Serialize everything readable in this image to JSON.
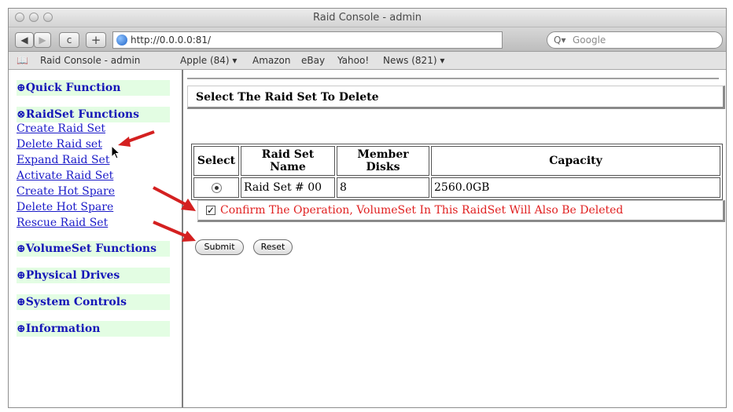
{
  "window": {
    "title": "Raid Console - admin"
  },
  "toolbar": {
    "url": "http://0.0.0.0:81/",
    "search_placeholder": "Google",
    "reload_glyph": "c",
    "add_glyph": "+"
  },
  "bookmarks": [
    "Raid Console - admin",
    "Apple (84) ▾",
    "Amazon",
    "eBay",
    "Yahoo!",
    "News (821) ▾"
  ],
  "sidebar": {
    "quick_function": "⊕Quick Function",
    "raidset_functions": "⊗RaidSet Functions",
    "raidset_links": [
      "Create Raid Set",
      "Delete Raid set",
      "Expand Raid Set",
      "Activate Raid Set",
      "Create Hot Spare",
      "Delete Hot Spare",
      "Rescue Raid Set"
    ],
    "volumeset_functions": "⊕VolumeSet Functions",
    "physical_drives": "⊕Physical Drives",
    "system_controls": "⊕System Controls",
    "information": "⊕Information"
  },
  "main": {
    "heading": "Select The Raid Set To Delete",
    "table": {
      "headers": [
        "Select",
        "Raid Set Name",
        "Member Disks",
        "Capacity"
      ],
      "rows": [
        {
          "name": "Raid Set # 00",
          "member_disks": "8",
          "capacity": "2560.0GB",
          "selected": true
        }
      ]
    },
    "confirm_label": "Confirm The Operation, VolumeSet In This RaidSet Will Also Be Deleted",
    "confirm_checked": true,
    "submit_label": "Submit",
    "reset_label": "Reset"
  },
  "colors": {
    "menu_bg": "#e3fde3",
    "link": "#1a1ac8",
    "warning": "#e02020",
    "annotation_arrow": "#d42020"
  }
}
